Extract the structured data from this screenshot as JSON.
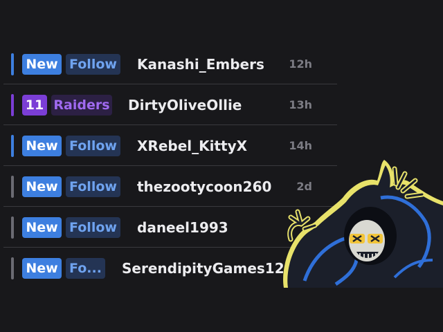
{
  "colors": {
    "background": "#18181b",
    "follow_accent": "#3d7fe0",
    "raid_accent": "#7b3ed6",
    "read_marker": "#6b6b73"
  },
  "feed": {
    "items": [
      {
        "badge": "New",
        "action": "Follow",
        "username": "Kanashi_Embers",
        "time": "12h",
        "kind": "follow",
        "unread": true
      },
      {
        "badge": "11",
        "action": "Raiders",
        "username": "DirtyOliveOllie",
        "time": "13h",
        "kind": "raid",
        "unread": true
      },
      {
        "badge": "New",
        "action": "Follow",
        "username": "XRebel_KittyX",
        "time": "14h",
        "kind": "follow",
        "unread": true
      },
      {
        "badge": "New",
        "action": "Follow",
        "username": "thezootycoon260",
        "time": "2d",
        "kind": "follow",
        "unread": false
      },
      {
        "badge": "New",
        "action": "Follow",
        "username": "daneel1993",
        "time": "",
        "kind": "follow",
        "unread": false
      },
      {
        "badge": "New",
        "action": "Fo...",
        "username": "SerendipityGames1243",
        "time": "",
        "kind": "follow",
        "unread": false
      }
    ]
  },
  "overlay": {
    "mascot_icon": "grim-reaper-mascot-icon"
  }
}
